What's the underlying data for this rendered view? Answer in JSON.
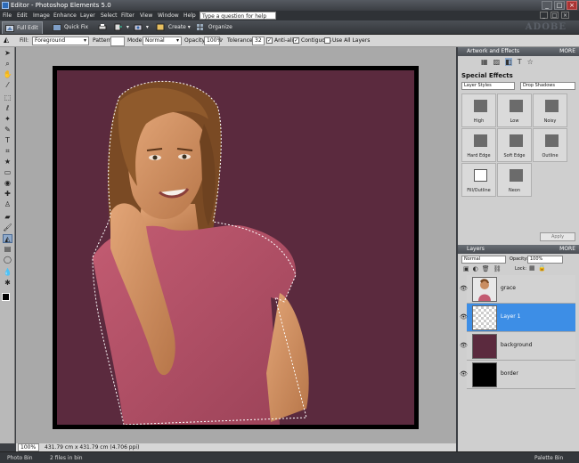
{
  "window": {
    "title": "Editor - Photoshop Elements 5.0",
    "controls": [
      "_",
      "□",
      "×"
    ]
  },
  "menu": {
    "items": [
      "File",
      "Edit",
      "Image",
      "Enhance",
      "Layer",
      "Select",
      "Filter",
      "View",
      "Window",
      "Help"
    ],
    "help_placeholder": "Type a question for help"
  },
  "shortcuts": {
    "tabs": [
      "Full Edit",
      "Quick Fix"
    ],
    "create_label": "Create",
    "organize_label": "Organize",
    "brand": "ADOBE"
  },
  "options": {
    "fill_label": "Fill:",
    "fill_value": "Foreground",
    "pattern_label": "Pattern:",
    "mode_label": "Mode:",
    "mode_value": "Normal",
    "opacity_label": "Opacity:",
    "opacity_value": "100%",
    "tolerance_label": "Tolerance:",
    "tolerance_value": "32",
    "antialias_label": "Anti-alias",
    "contiguous_label": "Contiguous",
    "use_all_layers_label": "Use All Layers",
    "antialias_checked": true,
    "contiguous_checked": true,
    "use_all_layers_checked": false
  },
  "status": {
    "zoom": "100%",
    "doc_size": "431.79 cm x 431.79 cm (4.706 ppi)"
  },
  "bottom_bin": {
    "photo_bin": "Photo Bin",
    "files_in_bin": "2 files in bin",
    "palette_bin": "Palette Bin"
  },
  "artwork_panel": {
    "title": "Artwork and Effects",
    "more": "MORE",
    "section": "Special Effects",
    "category": "Layer Styles",
    "subcategory": "Drop Shadows",
    "effects": [
      "High",
      "Low",
      "Noisy",
      "Hard Edge",
      "Soft Edge",
      "Outline",
      "Fill/Outline",
      "Neon"
    ],
    "apply_label": "Apply"
  },
  "layers_panel": {
    "title": "Layers",
    "more": "MORE",
    "blend_mode": "Normal",
    "opacity_label": "Opacity:",
    "opacity_value": "100%",
    "lock_label": "Lock:",
    "layers": [
      {
        "name": "grace"
      },
      {
        "name": "Layer 1"
      },
      {
        "name": "background"
      },
      {
        "name": "border"
      }
    ]
  },
  "colors": {
    "canvas_background": "#5b2a3e",
    "selected_layer": "#3d8ee6"
  }
}
